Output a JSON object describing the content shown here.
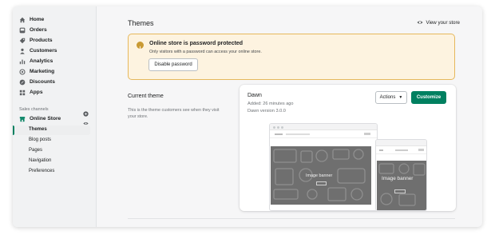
{
  "sidebar": {
    "items": [
      {
        "label": "Home",
        "icon": "home-icon"
      },
      {
        "label": "Orders",
        "icon": "orders-icon"
      },
      {
        "label": "Products",
        "icon": "tag-icon"
      },
      {
        "label": "Customers",
        "icon": "person-icon"
      },
      {
        "label": "Analytics",
        "icon": "bar-chart-icon"
      },
      {
        "label": "Marketing",
        "icon": "target-icon"
      },
      {
        "label": "Discounts",
        "icon": "discount-icon"
      },
      {
        "label": "Apps",
        "icon": "apps-icon"
      }
    ],
    "sales_channels_label": "Sales channels",
    "online_store": {
      "label": "Online Store",
      "icon": "store-icon"
    },
    "sub_items": [
      {
        "label": "Themes",
        "active": true
      },
      {
        "label": "Blog posts",
        "active": false
      },
      {
        "label": "Pages",
        "active": false
      },
      {
        "label": "Navigation",
        "active": false
      },
      {
        "label": "Preferences",
        "active": false
      }
    ]
  },
  "header": {
    "title": "Themes",
    "view_store_label": "View your store"
  },
  "banner": {
    "title": "Online store is password protected",
    "text": "Only visitors with a password can access your online store.",
    "button_label": "Disable password"
  },
  "current_theme": {
    "title": "Current theme",
    "description": "This is the theme customers see when they visit your store.",
    "theme_name": "Dawn",
    "added": "Added: 26 minutes ago",
    "version": "Dawn version 3.0.0",
    "actions_label": "Actions",
    "customize_label": "Customize",
    "preview_banner_label": "Image banner"
  },
  "colors": {
    "accent": "#008060",
    "banner_bg": "#fdf3e0",
    "banner_border": "#e6b85c"
  }
}
